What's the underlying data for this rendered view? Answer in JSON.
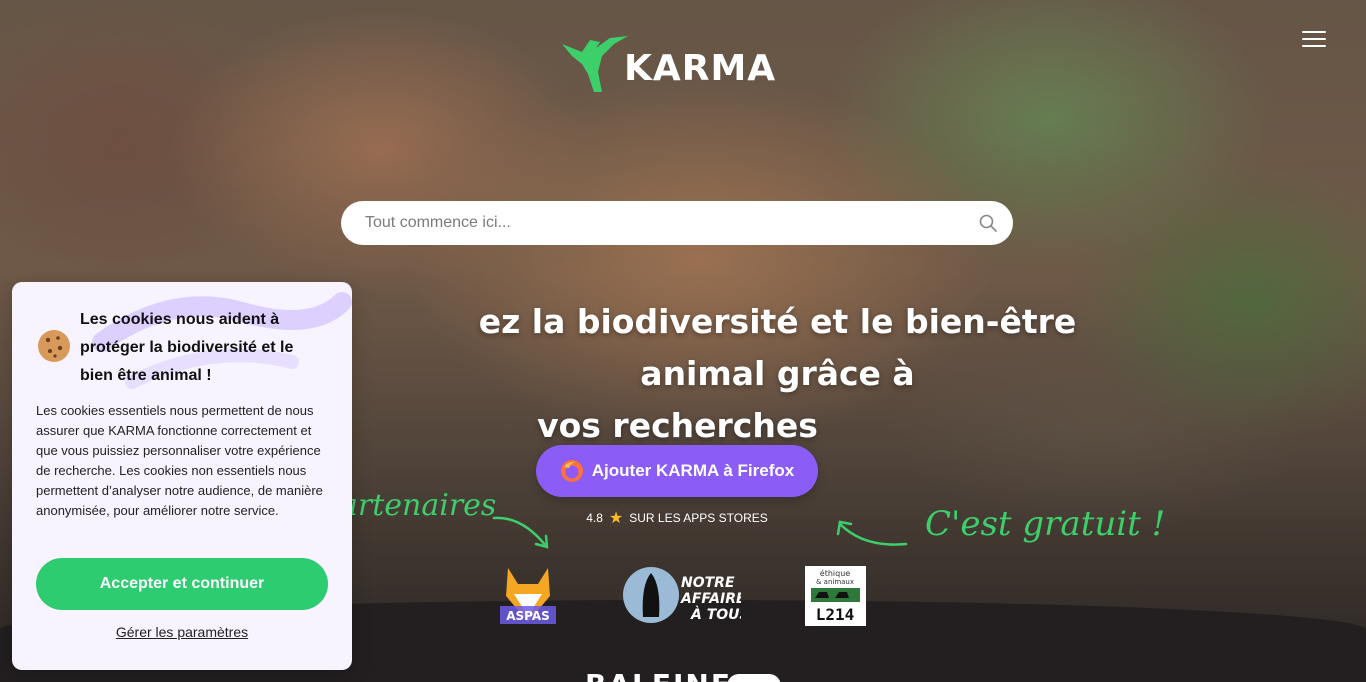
{
  "header": {
    "logo_text": "KARMA",
    "menu_icon": "hamburger-menu-icon"
  },
  "search": {
    "placeholder": "Tout commence ici...",
    "icon": "search-icon"
  },
  "hero": {
    "headline_line1": "ez la biodiversité et le bien-être animal grâce à",
    "headline_line2": "vos recherches",
    "cta_label": "Ajouter KARMA à Firefox",
    "cta_icon": "firefox-icon",
    "rating_value": "4.8",
    "rating_text": "SUR LES APPS STORES",
    "partners_script": "artenaires",
    "free_script": "C'est gratuit !",
    "footer_brand_partial": "BALEINE"
  },
  "partners": [
    {
      "name": "ASPAS",
      "icon": "aspas-logo"
    },
    {
      "name": "NOTRE AFFAIRE À TOUS",
      "icon": "notre-affaire-a-tous-logo"
    },
    {
      "name": "L214",
      "icon": "l214-logo",
      "subtitle": "éthique & animaux"
    }
  ],
  "cookie": {
    "title": "Les cookies nous aident à protéger la biodiversité et le bien être animal !",
    "body": "Les cookies essentiels nous permettent de nous assurer que KARMA fonctionne correctement et que vous puissiez personnaliser votre expérience de recherche. Les cookies non essentiels nous permettent d’analyser notre audience, de manière anonymisée, pour améliorer notre service.",
    "accept_label": "Accepter et continuer",
    "manage_label": "Gérer les paramètres"
  },
  "colors": {
    "brand_green": "#3ccf6a",
    "cta_purple": "#8b5cf6",
    "accept_green": "#2dcc70",
    "cookie_bg": "#f8f4ff"
  }
}
